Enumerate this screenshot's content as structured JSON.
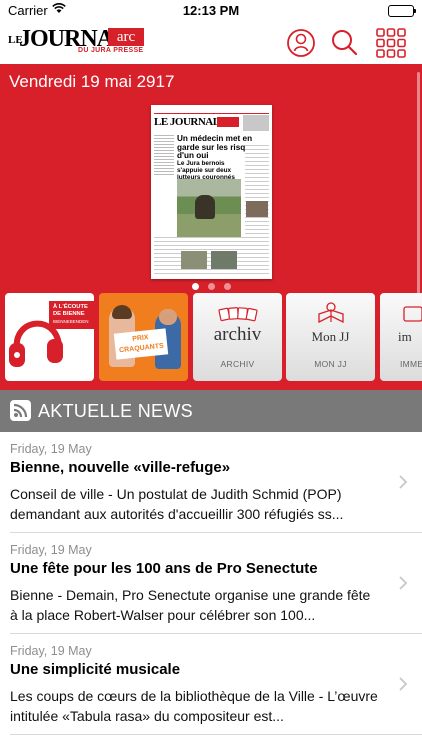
{
  "status_bar": {
    "carrier": "Carrier",
    "time": "12:13 PM"
  },
  "header": {
    "logo": {
      "le": "LE",
      "journal": "JOURNAL",
      "arc": "arc",
      "subline": "DU JURA  PRESSE"
    },
    "icons": [
      "account-icon",
      "search-icon",
      "grid-menu-icon"
    ],
    "accent_color": "#d7202a"
  },
  "hero": {
    "date": "Vendredi 19 mai 2917",
    "front_page": {
      "masthead": "LE JOURNAL",
      "headline": "Un médecin met en garde sur les risques d'un oui",
      "subheadline": "Le Jura bernois s'appuie sur deux lutteurs couronnés"
    },
    "pager": {
      "count": 3,
      "active_index": 0
    }
  },
  "carousel": [
    {
      "id": "ecoute",
      "band": "À L'ÉCOUTE DE BIENNE",
      "band_sub": "BIENNEBENDEN"
    },
    {
      "id": "prix",
      "sign_line1": "PRIX",
      "sign_line2": "CRAQUANTS"
    },
    {
      "id": "archiv",
      "big": "archiv",
      "label": "ARCHIV"
    },
    {
      "id": "monjj",
      "big": "Mon JJ",
      "label": "MON JJ"
    },
    {
      "id": "imme",
      "big": "im",
      "label": "IMME"
    }
  ],
  "section": {
    "title": "AKTUELLE NEWS"
  },
  "news": [
    {
      "date": "Friday, 19 May",
      "title": "Bienne, nouvelle «ville-refuge»",
      "body": "Conseil de ville - Un postulat de Judith Schmid (POP) demandant aux autorités d'accueillir 300 réfugiés ss..."
    },
    {
      "date": "Friday, 19 May",
      "title": "Une fête pour les 100 ans de Pro Senectute",
      "body": "Bienne - Demain, Pro Senectute organise une grande fête à la place Robert-Walser pour célébrer son 100..."
    },
    {
      "date": "Friday, 19 May",
      "title": "Une simplicité musicale",
      "body": "Les coups de cœurs de la bibliothèque de la Ville - L’œuvre intitulée «Tabula rasa» du compositeur est..."
    }
  ]
}
